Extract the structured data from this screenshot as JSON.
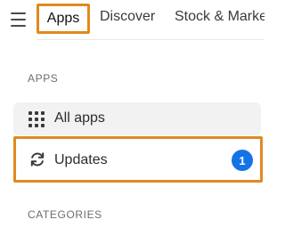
{
  "topnav": {
    "menu_icon": "hamburger-menu-icon",
    "tabs": [
      {
        "label": "Apps",
        "selected": true
      },
      {
        "label": "Discover",
        "selected": false
      },
      {
        "label": "Stock & Marke",
        "selected": false
      }
    ]
  },
  "sidebar": {
    "apps_heading": "APPS",
    "items": [
      {
        "label": "All apps",
        "icon": "grid-icon"
      },
      {
        "label": "Updates",
        "icon": "refresh-icon",
        "badge": "1"
      }
    ],
    "categories_heading": "CATEGORIES"
  },
  "colors": {
    "highlight": "#e08a1e",
    "badge": "#1473e6",
    "item_bg": "#f2f2f2"
  }
}
